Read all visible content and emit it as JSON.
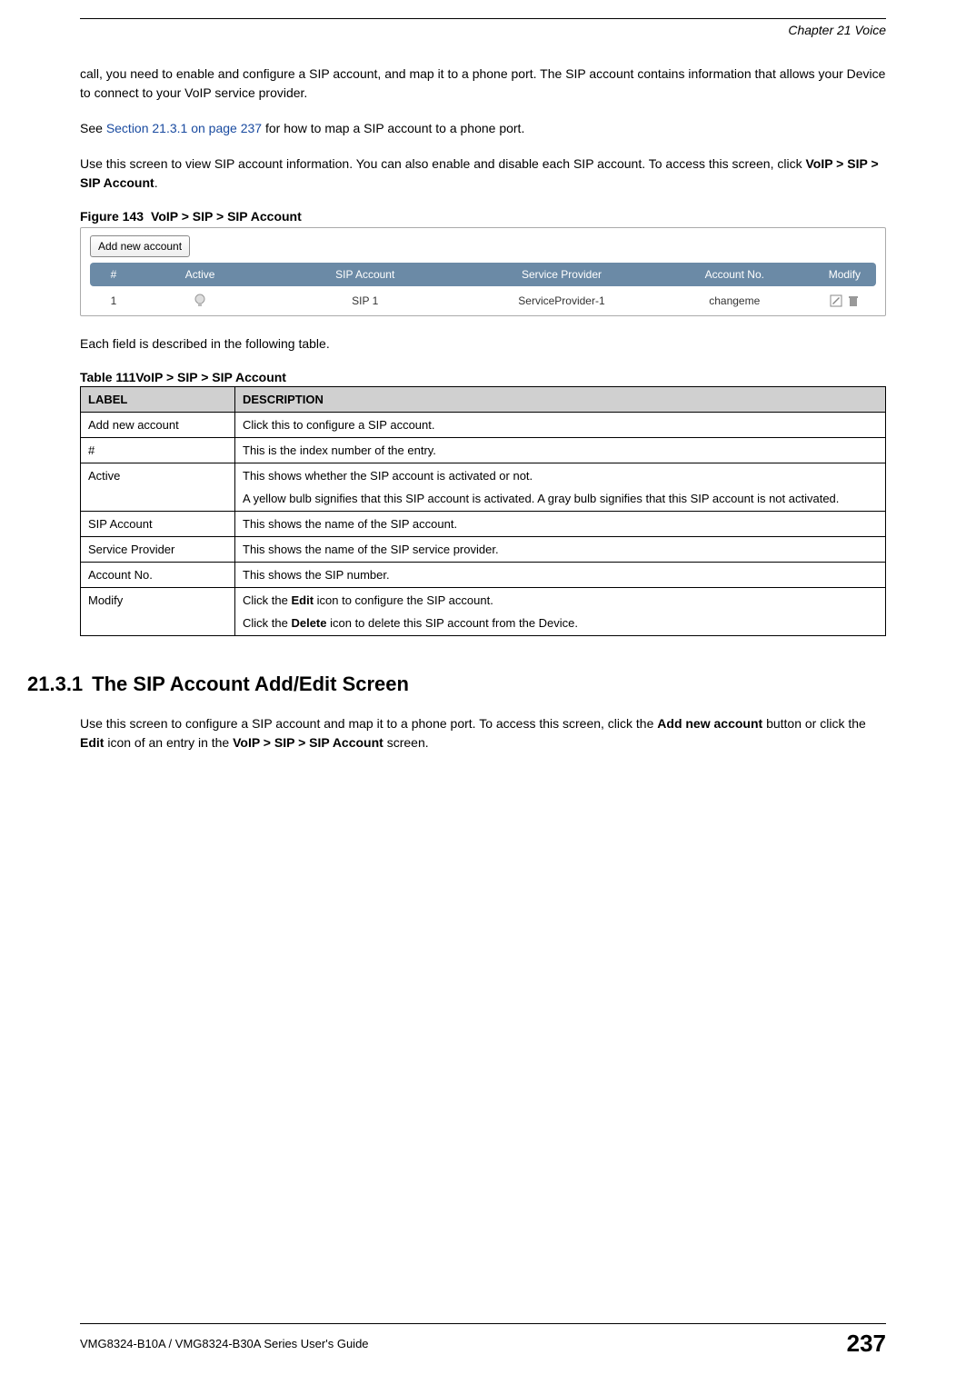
{
  "header": {
    "chapter": "Chapter 21 Voice"
  },
  "paragraphs": {
    "p1": "call, you need to enable and configure a SIP account, and map it to a phone port. The SIP account contains information that allows your Device to connect to your VoIP service provider.",
    "p2_prefix": "See ",
    "p2_link": "Section 21.3.1 on page 237",
    "p2_suffix": " for how to map a SIP account to a phone port.",
    "p3_a": "Use this screen to view SIP account information. You can also enable and disable each SIP account. To access this screen, click ",
    "p3_b": "VoIP > SIP > SIP Account",
    "p3_c": ".",
    "p4": "Each field is described in the following table."
  },
  "figure": {
    "caption_label": "Figure 143",
    "caption_text": "VoIP > SIP > SIP Account",
    "add_button": "Add new account",
    "headers": {
      "num": "#",
      "active": "Active",
      "sip_account": "SIP Account",
      "service_provider": "Service Provider",
      "account_no": "Account No.",
      "modify": "Modify"
    },
    "row": {
      "num": "1",
      "sip_account": "SIP 1",
      "service_provider": "ServiceProvider-1",
      "account_no": "changeme"
    }
  },
  "table111": {
    "caption_label": "Table 111",
    "caption_text": "VoIP > SIP > SIP Account",
    "head_label": "LABEL",
    "head_desc": "DESCRIPTION",
    "rows": {
      "add": {
        "label": "Add new account",
        "desc": "Click this to configure a SIP account."
      },
      "num": {
        "label": "#",
        "desc": "This is the index number of the entry."
      },
      "active": {
        "label": "Active",
        "desc1": "This shows whether the SIP account is activated or not.",
        "desc2": "A yellow bulb signifies that this SIP account is activated. A gray bulb signifies that this SIP account is not activated."
      },
      "sip": {
        "label": "SIP Account",
        "desc": "This shows the name of the SIP account."
      },
      "sp": {
        "label": "Service Provider",
        "desc": "This shows the name of the SIP service provider."
      },
      "an": {
        "label": "Account No.",
        "desc": "This shows the SIP number."
      },
      "modify": {
        "label": "Modify",
        "desc1_a": "Click the ",
        "desc1_b": "Edit",
        "desc1_c": " icon to configure the SIP account.",
        "desc2_a": "Click the ",
        "desc2_b": "Delete",
        "desc2_c": " icon to delete this SIP account from the Device."
      }
    }
  },
  "section": {
    "number": "21.3.1",
    "title": "The SIP Account Add/Edit Screen",
    "body_a": "Use this screen to configure a SIP account and map it to a phone port. To access this screen, click the ",
    "body_b": "Add new account",
    "body_c": " button or click the ",
    "body_d": "Edit",
    "body_e": " icon of an entry in the ",
    "body_f": "VoIP > SIP > SIP Account",
    "body_g": " screen."
  },
  "footer": {
    "guide": "VMG8324-B10A / VMG8324-B30A Series User's Guide",
    "page": "237"
  }
}
